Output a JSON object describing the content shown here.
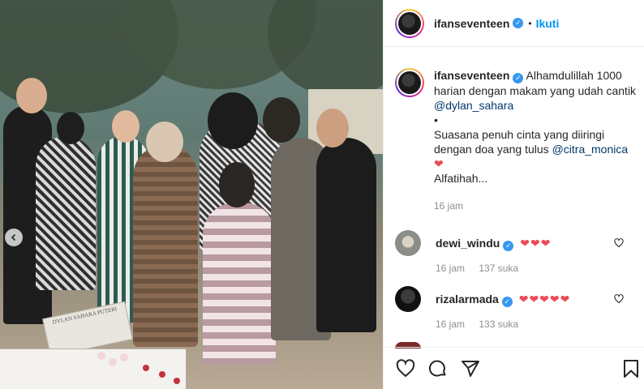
{
  "post": {
    "username": "ifanseventeen",
    "follow_label": "Ikuti",
    "separator": "•",
    "caption": {
      "line1": "Alhamdulillah 1000 harian dengan makam yang udah cantik ",
      "mention1": "@dylan_sahara",
      "bullet": "•",
      "line2": "Suasana penuh cinta yang diiringi dengan doa yang tulus ",
      "mention2": "@citra_monica",
      "heart": "❤",
      "line3": "Alfatihah...",
      "time": "16 jam"
    }
  },
  "photo": {
    "gravestone_text": "DYLAN SAHARA PUTERI"
  },
  "comments": [
    {
      "username": "dewi_windu",
      "hearts": "❤❤❤",
      "time": "16 jam",
      "likes": "137 suka"
    },
    {
      "username": "rizalarmada",
      "hearts": "❤❤❤❤❤",
      "time": "16 jam",
      "likes": "133 suka"
    }
  ],
  "colors": {
    "link": "#0095f6",
    "mention": "#00376b",
    "heart": "#ed4956",
    "verified": "#3897f0",
    "meta": "#8e8e8e"
  },
  "icons": [
    "verified-icon",
    "heart-icon",
    "comment-icon",
    "share-icon",
    "bookmark-icon",
    "carousel-left-icon"
  ]
}
